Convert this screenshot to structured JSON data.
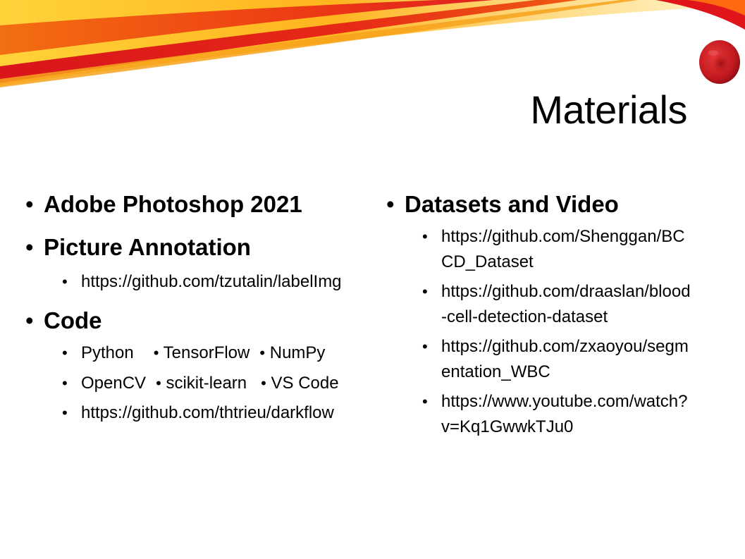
{
  "colors": {
    "swoosh_red": "#e0151c",
    "swoosh_orange": "#f46a0e",
    "swoosh_yellow": "#ffc21a",
    "cell_red": "#c81a1f",
    "text": "#000000"
  },
  "title": "Materials",
  "bullet_glyph": "•",
  "left_column": {
    "photoshop": "Adobe Photoshop 2021",
    "annotation": {
      "heading": "Picture Annotation",
      "link": "https://github.com/tzutalin/labelImg"
    },
    "code": {
      "heading": "Code",
      "tools_row1": [
        "Python",
        "TensorFlow",
        "NumPy"
      ],
      "tools_row2": [
        "OpenCV",
        "scikit-learn",
        "VS Code"
      ],
      "link": "https://github.com/thtrieu/darkflow"
    }
  },
  "right_column": {
    "heading": "Datasets and Video",
    "links": [
      {
        "line1": "https://github.com/Shenggan/BC",
        "line2": "CD_Dataset"
      },
      {
        "line1": "https://github.com/draaslan/blood",
        "line2": "-cell-detection-dataset"
      },
      {
        "line1": "https://github.com/zxaoyou/segm",
        "line2": "entation_WBC"
      },
      {
        "line1": "https://www.youtube.com/watch?",
        "line2": "v=Kq1GwwkTJu0"
      }
    ]
  }
}
